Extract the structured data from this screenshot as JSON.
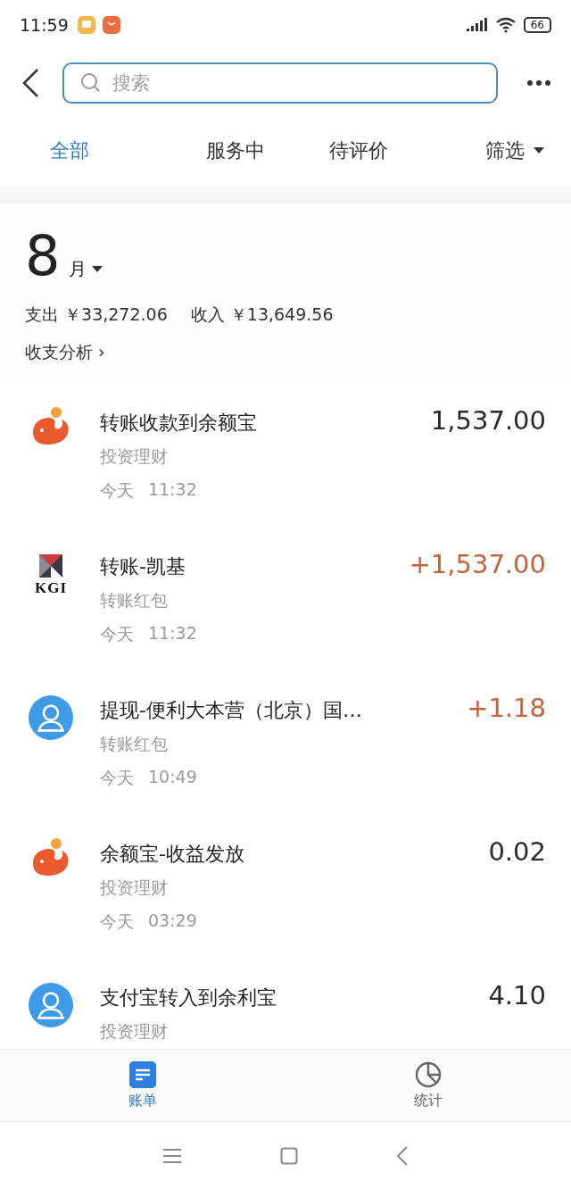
{
  "status_bar": {
    "time": "11:59",
    "battery": "66"
  },
  "header": {
    "search": {
      "placeholder": "搜索"
    }
  },
  "tabs": [
    {
      "label": "全部",
      "selected": true,
      "kind": "plain"
    },
    {
      "label": "服务中",
      "selected": false,
      "kind": "plain"
    },
    {
      "label": "待评价",
      "selected": false,
      "kind": "plain"
    },
    {
      "label": "筛选",
      "selected": false,
      "kind": "dropdown"
    }
  ],
  "summary": {
    "month": "8",
    "month_unit": "月",
    "expense_label": "支出",
    "expense": "￥33,272.06",
    "income_label": "收入",
    "income": "￥13,649.56",
    "analysis_link": "收支分析 ›"
  },
  "transactions": [
    {
      "kind": "yuebao",
      "title": "转账收款到余额宝",
      "category": "投资理财",
      "date": "今天",
      "time": "11:32",
      "amount": "1,537.00",
      "income": false
    },
    {
      "kind": "kgi",
      "logo_text": "KGI",
      "title": "转账-凯基",
      "category": "转账红包",
      "date": "今天",
      "time": "11:32",
      "amount": "+1,537.00",
      "income": true
    },
    {
      "kind": "person",
      "title": "提现-便利大本营（北京）国…",
      "category": "转账红包",
      "date": "今天",
      "time": "10:49",
      "amount": "+1.18",
      "income": true
    },
    {
      "kind": "yuebao",
      "title": "余额宝-收益发放",
      "category": "投资理财",
      "date": "今天",
      "time": "03:29",
      "amount": "0.02",
      "income": false
    },
    {
      "kind": "person",
      "title": "支付宝转入到余利宝",
      "category": "投资理财",
      "amount": "4.10",
      "income": false
    }
  ],
  "bottom_nav": [
    {
      "kind": "bill",
      "label": "账单",
      "selected": true
    },
    {
      "kind": "stats",
      "label": "统计",
      "selected": false
    }
  ]
}
